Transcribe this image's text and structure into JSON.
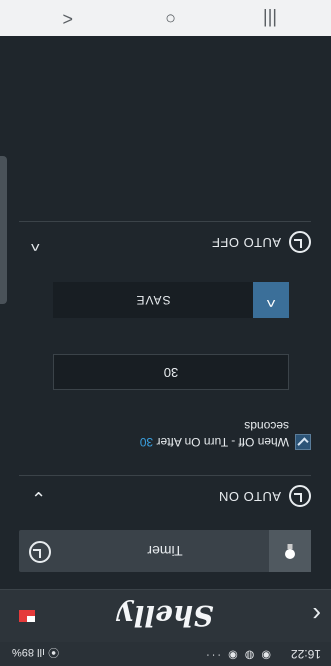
{
  "status_bar": {
    "time": "16:22",
    "left_icons": "◉ ◍ ◉ ···",
    "signal": "⦿ ıll",
    "battery": "89%"
  },
  "app_bar": {
    "back_icon": "chevron-left-icon",
    "logo_text": "Shelly",
    "flag_icon": "flag-icon"
  },
  "timer": {
    "label": "Timer",
    "bulb_icon": "lightbulb-icon",
    "clock_icon": "clock-icon"
  },
  "auto_on": {
    "title": "AUTO ON",
    "chevron": "⌄"
  },
  "auto_off_option": {
    "text_prefix": "When Off - Turn On After ",
    "seconds_value": "30",
    "text_suffix": "seconds",
    "checked": true
  },
  "seconds_input": {
    "value": "30"
  },
  "save": {
    "label": "SAVE",
    "up_icon": "^"
  },
  "auto_off": {
    "title": "AUTO OFF",
    "chevron": "^"
  },
  "nav_bar": {
    "recent": "|||",
    "home": "○",
    "back": "<"
  }
}
